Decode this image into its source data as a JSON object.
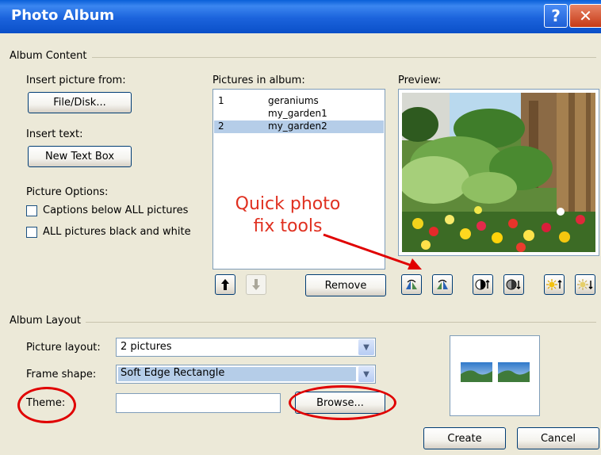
{
  "window": {
    "title": "Photo Album",
    "help_icon": "question-mark",
    "close_icon": "x"
  },
  "album_content": {
    "group_label": "Album Content",
    "insert_picture_label": "Insert picture from:",
    "file_disk_button": "File/Disk...",
    "insert_text_label": "Insert text:",
    "new_text_box_button": "New Text Box",
    "picture_options_label": "Picture Options:",
    "captions_checkbox_label": "Captions below ALL pictures",
    "captions_checked": false,
    "black_white_checkbox_label": "ALL pictures black and white",
    "black_white_checked": false
  },
  "pictures": {
    "label": "Pictures in album:",
    "items": [
      {
        "num": "1",
        "name": "geraniums",
        "selected": false
      },
      {
        "num": "",
        "name": "my_garden1",
        "selected": false
      },
      {
        "num": "2",
        "name": "my_garden2",
        "selected": true
      }
    ],
    "move_up_icon": "arrow-up-icon",
    "move_down_icon": "arrow-down-icon",
    "remove_button": "Remove"
  },
  "preview": {
    "label": "Preview:",
    "tools": [
      "rotate-left-icon",
      "rotate-right-icon",
      "contrast-up-icon",
      "contrast-down-icon",
      "brightness-up-icon",
      "brightness-down-icon"
    ]
  },
  "annotation": {
    "line1": "Quick photo",
    "line2": "fix tools",
    "color": "#e03020"
  },
  "album_layout": {
    "group_label": "Album Layout",
    "picture_layout_label": "Picture layout:",
    "picture_layout_value": "2 pictures",
    "frame_shape_label": "Frame shape:",
    "frame_shape_value": "Soft Edge Rectangle",
    "theme_label": "Theme:",
    "theme_value": "",
    "browse_button": "Browse..."
  },
  "buttons": {
    "create": "Create",
    "cancel": "Cancel"
  },
  "colors": {
    "title_bar": "#0a5fd8",
    "dialog_bg": "#ece9d8",
    "selection": "#b5cde8",
    "annotation_red": "#e00000"
  }
}
